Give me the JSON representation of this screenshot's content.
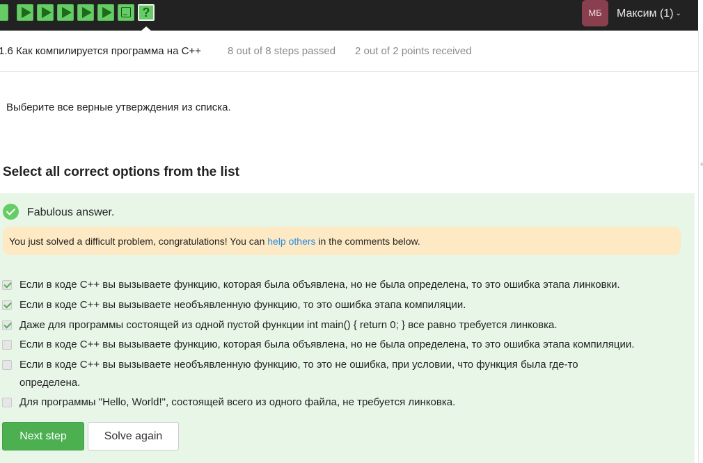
{
  "topbar": {
    "steps": [
      {
        "icon": "completed-step-icon"
      },
      {
        "icon": "play-icon"
      },
      {
        "icon": "play-icon"
      },
      {
        "icon": "play-icon"
      },
      {
        "icon": "play-icon"
      },
      {
        "icon": "play-icon"
      },
      {
        "icon": "terminal-icon"
      },
      {
        "icon": "question-icon",
        "glyph": "?",
        "active": true
      }
    ],
    "avatar_initials": "МБ",
    "user_name": "Максим (1)",
    "user_menu_icon": "chevron-down-icon"
  },
  "header": {
    "lesson_title": "1.6 Как компилируется программа на C++",
    "steps_passed": "8 out of 8 steps passed",
    "points": "2 out of 2 points  received"
  },
  "question": {
    "text": "Выберите все верные утверждения из списка."
  },
  "prompt_heading": "Select all correct options from the list",
  "feedback": {
    "status_icon": "check-circle-icon",
    "title": "Fabulous answer.",
    "hint_before": "You just solved a difficult problem, congratulations! You can ",
    "hint_link": "help others",
    "hint_after": " in the comments below."
  },
  "options": [
    {
      "text": "Если в коде C++ вы вызываете функцию, которая была объявлена, но не была определена, то это ошибка этапа линковки.",
      "checked": true
    },
    {
      "text": "Если в коде C++ вы вызываете необъявленную функцию, то это ошибка этапа компиляции.",
      "checked": true
    },
    {
      "text": "Даже для программы состоящей из одной пустой функции int main() { return 0; } все равно требуется линковка.",
      "checked": true
    },
    {
      "text": "Если в коде C++ вы вызываете функцию, которая была объявлена, но не была определена, то это ошибка этапа компиляции.",
      "checked": false
    },
    {
      "text": "Если в коде C++ вы вызываете необъявленную функцию, то это не ошибка, при условии, что функция была где-то определена.",
      "checked": false
    },
    {
      "text": "Для программы \"Hello, World!\", состоящей всего из одного файла, не требуется линковка.",
      "checked": false
    }
  ],
  "buttons": {
    "next": "Next step",
    "again": "Solve again"
  },
  "colors": {
    "topbar": "#222222",
    "step_green": "#66cc66",
    "success_bg": "#e8f6e8",
    "hint_bg": "#fde9c3",
    "link": "#2a8ae0",
    "primary_button": "#4caf50"
  }
}
